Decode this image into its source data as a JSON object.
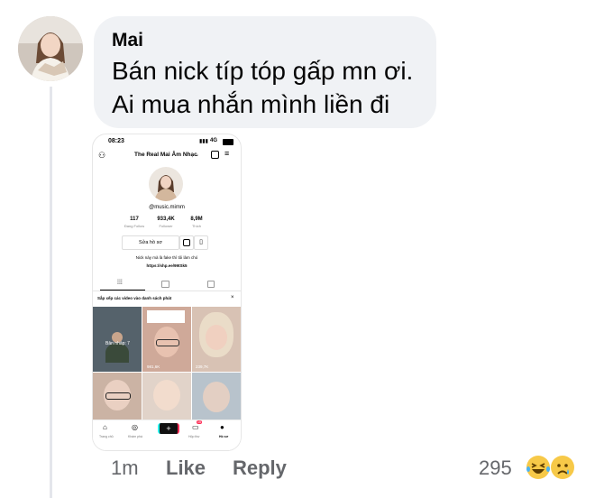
{
  "comment": {
    "author": "Mai",
    "text_line1": "Bán nick típ tóp gấp mn ơi.",
    "text_line2": "Ai mua nhắn mình liền đi"
  },
  "attachment": {
    "status_time": "08:23",
    "network": "4G",
    "profile_name": "The Real Mai Âm Nhạc",
    "username": "@music.mimm",
    "stats": [
      {
        "value": "117",
        "label": "Đang Follow"
      },
      {
        "value": "933,4K",
        "label": "Follower"
      },
      {
        "value": "8,9M",
        "label": "Thích"
      }
    ],
    "edit_button": "Sửa hồ sơ",
    "bio": "Nick này mà là fake thì tôi làm chó",
    "link": "https://shp.ee/99tSk5",
    "playlist_prompt": "Sắp xếp các video vào danh sách phát",
    "draft_label": "Bản nháp: 7",
    "video_counts": [
      "981,6K",
      "239,7K"
    ],
    "nav": [
      "Trang chủ",
      "Khám phá",
      "",
      "Hộp thư",
      "Hồ sơ"
    ],
    "inbox_badge": "15"
  },
  "actions": {
    "time": "1m",
    "like": "Like",
    "reply": "Reply",
    "reaction_count": "295",
    "reactions": [
      "laughing-emoji",
      "sad-tear-emoji"
    ]
  }
}
